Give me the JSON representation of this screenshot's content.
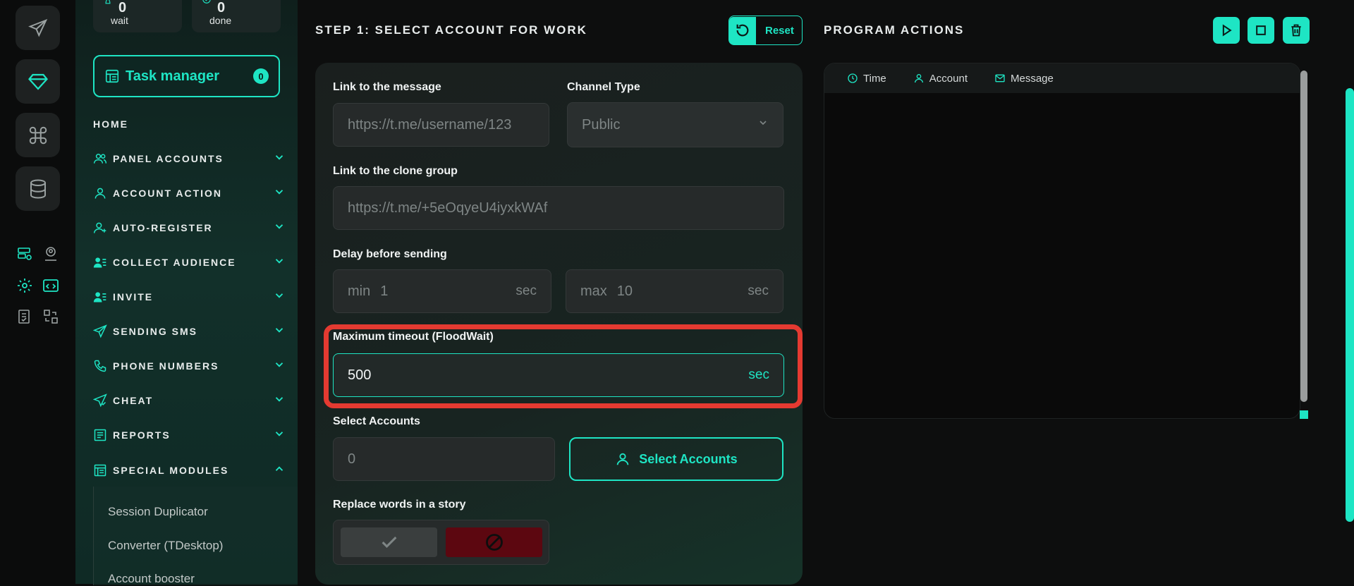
{
  "rail": {
    "buttons": [
      "send-icon",
      "diamond-icon",
      "command-icon",
      "database-icon"
    ],
    "mini_icons": [
      "server-check-icon",
      "user-pin-icon",
      "gear-icon",
      "code-window-icon",
      "checklist-icon",
      "grid-swap-icon"
    ]
  },
  "stats": {
    "wait": {
      "value": "0",
      "label": "wait"
    },
    "done": {
      "value": "0",
      "label": "done"
    }
  },
  "task_manager": {
    "label": "Task manager",
    "count": "0"
  },
  "nav": {
    "home": "HOME",
    "items": [
      {
        "label": "PANEL ACCOUNTS",
        "icon": "users-icon",
        "expanded": false
      },
      {
        "label": "ACCOUNT ACTION",
        "icon": "user-icon",
        "expanded": false
      },
      {
        "label": "AUTO-REGISTER",
        "icon": "user-plus-icon",
        "expanded": false
      },
      {
        "label": "COLLECT AUDIENCE",
        "icon": "user-list-icon",
        "expanded": false
      },
      {
        "label": "INVITE",
        "icon": "user-list-icon",
        "expanded": false
      },
      {
        "label": "SENDING SMS",
        "icon": "paper-plane-icon",
        "expanded": false
      },
      {
        "label": "PHONE NUMBERS",
        "icon": "phone-icon",
        "expanded": false
      },
      {
        "label": "CHEAT",
        "icon": "send-check-icon",
        "expanded": false
      },
      {
        "label": "REPORTS",
        "icon": "report-icon",
        "expanded": false
      },
      {
        "label": "SPECIAL MODULES",
        "icon": "modules-icon",
        "expanded": true
      }
    ],
    "submenu": [
      "Session Duplicator",
      "Converter (TDesktop)",
      "Account booster"
    ]
  },
  "step": {
    "title": "STEP 1: SELECT ACCOUNT FOR WORK",
    "reset_label": "Reset"
  },
  "form": {
    "message_link": {
      "label": "Link to the message",
      "placeholder": "https://t.me/username/123"
    },
    "channel_type": {
      "label": "Channel Type",
      "value": "Public"
    },
    "clone_group": {
      "label": "Link to the clone group",
      "placeholder": "https://t.me/+5eOqyeU4iyxkWAf"
    },
    "delay": {
      "label": "Delay before sending",
      "min_prefix": "min",
      "min_value": "1",
      "max_prefix": "max",
      "max_value": "10",
      "unit": "sec"
    },
    "floodwait": {
      "label": "Maximum timeout (FloodWait)",
      "value": "500",
      "unit": "sec"
    },
    "accounts": {
      "label": "Select Accounts",
      "value": "0",
      "button": "Select Accounts"
    },
    "replace_words": {
      "label": "Replace words in a story",
      "enabled": false
    }
  },
  "actions": {
    "title": "PROGRAM ACTIONS",
    "buttons": [
      "play-icon",
      "stop-icon",
      "trash-icon"
    ]
  },
  "log": {
    "columns": [
      {
        "label": "Time",
        "icon": "clock-icon"
      },
      {
        "label": "Account",
        "icon": "user-icon"
      },
      {
        "label": "Message",
        "icon": "mail-icon"
      }
    ],
    "rows": []
  },
  "colors": {
    "accent": "#1ee5c4",
    "highlight": "#e43a31",
    "danger": "#5c0710"
  }
}
